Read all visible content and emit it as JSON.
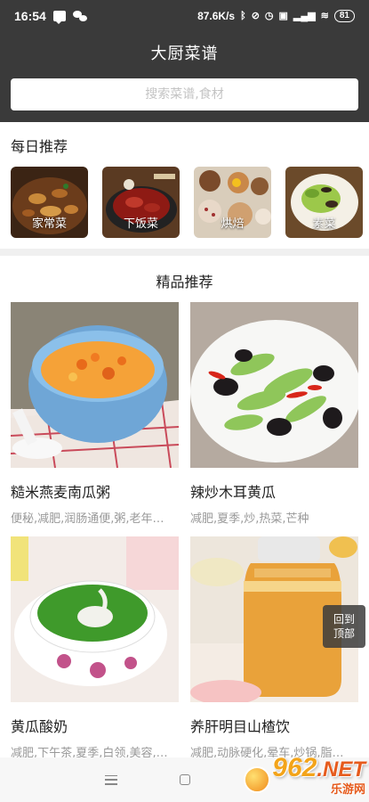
{
  "status_bar": {
    "time": "16:54",
    "net_speed": "87.6K/s",
    "battery": "81"
  },
  "header": {
    "title": "大厨菜谱"
  },
  "search": {
    "placeholder": "搜索菜谱,食材"
  },
  "daily": {
    "title": "每日推荐",
    "categories": [
      {
        "label": "家常菜"
      },
      {
        "label": "下饭菜"
      },
      {
        "label": "烘焙"
      },
      {
        "label": "素菜"
      }
    ]
  },
  "featured": {
    "title": "精品推荐",
    "recipes": [
      {
        "name": "糙米燕麦南瓜粥",
        "tags": "便秘,减肥,润肠通便,粥,老年…"
      },
      {
        "name": "辣炒木耳黄瓜",
        "tags": "减肥,夏季,炒,热菜,芒种"
      },
      {
        "name": "黄瓜酸奶",
        "tags": "减肥,下午茶,夏季,白领,美容,…"
      },
      {
        "name": "养肝明目山楂饮",
        "tags": "减肥,动脉硬化,晕车,炒锅,脂…"
      }
    ]
  },
  "back_to_top": {
    "line1": "回到",
    "line2": "顶部"
  },
  "watermark": {
    "logo": "962",
    "logo_suffix": ".NET",
    "subtitle": "乐游网"
  },
  "colors": {
    "header_bg": "#3a3a3a",
    "accent_orange": "#f3a41a"
  }
}
